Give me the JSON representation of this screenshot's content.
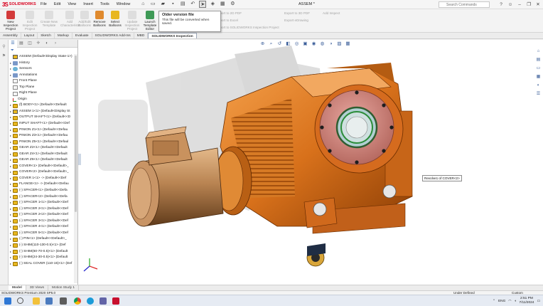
{
  "app": {
    "logo_text": "SOLIDWORKS",
    "document_title": "ASSEM *",
    "menu": [
      "File",
      "Edit",
      "View",
      "Insert",
      "Tools",
      "Window"
    ],
    "search_placeholder": "Search Commands"
  },
  "ribbon": {
    "buttons": [
      {
        "label": "New Inspection Project",
        "state": "enabled",
        "icon": "inspection-new-icon"
      },
      {
        "label": "Edit Inspection Project",
        "state": "disabled",
        "icon": "inspection-edit-icon"
      },
      {
        "label": "Create New Template",
        "state": "disabled",
        "icon": "template-new-icon"
      },
      {
        "label": "Add Characteristic",
        "state": "disabled",
        "icon": "characteristic-add-icon"
      },
      {
        "label": "Add/Edit Balloons",
        "state": "disabled",
        "icon": "balloon-edit-icon"
      },
      {
        "label": "Remove Balloons",
        "state": "enabled",
        "icon": "balloon-remove-icon"
      },
      {
        "label": "Select Balloons",
        "state": "enabled",
        "icon": "balloon-select-icon"
      },
      {
        "label": "Update Inspection Project",
        "state": "disabled",
        "icon": "inspection-update-icon"
      },
      {
        "label": "Launch Template Editor",
        "state": "enabled",
        "icon": "template-editor-icon"
      }
    ],
    "export_items": [
      "Export to 2D PDF",
      "Export to Excel",
      "Export to SOLIDWORKS Inspection Project",
      "Export to 3D PDF",
      "Export eDrawing",
      "Add Inspect"
    ],
    "tooltip": {
      "title": "Older version file",
      "body": "This file will be converted when saved."
    }
  },
  "tabs": [
    "Assembly",
    "Layout",
    "Sketch",
    "Markup",
    "Evaluate",
    "SOLIDWORKS Add-Ins",
    "MBD",
    "SOLIDWORKS Inspection"
  ],
  "active_tab": "SOLIDWORKS Inspection",
  "tree": {
    "root": "ASSEM  (Default<Display State-1>)",
    "items": [
      {
        "label": "History",
        "icon": "folder"
      },
      {
        "label": "Sensors",
        "icon": "sensor"
      },
      {
        "label": "Annotations",
        "icon": "folder"
      },
      {
        "label": "Front Plane",
        "icon": "plane"
      },
      {
        "label": "Top Plane",
        "icon": "plane"
      },
      {
        "label": "Right Plane",
        "icon": "plane"
      },
      {
        "label": "Origin",
        "icon": "origin"
      },
      {
        "label": "(f) BODY<1> (Default<<Default",
        "icon": "part"
      },
      {
        "label": "ASSEM 1<1> (Default<Display St",
        "icon": "asm"
      },
      {
        "label": "OUTPUT SHAFT<1> (Default<<D",
        "icon": "part"
      },
      {
        "label": "INPUT SHAFT<1> (Default<<Def",
        "icon": "part"
      },
      {
        "label": "PINION Z1<1> (Default<<Defau",
        "icon": "part"
      },
      {
        "label": "PINION Z3<1> (Default<<Defau",
        "icon": "part"
      },
      {
        "label": "PINION Z5<1> (Default<<Defaul",
        "icon": "part"
      },
      {
        "label": "GEAR Z2<1> (Default<<Default",
        "icon": "part"
      },
      {
        "label": "GEAR Z4<1> (Default<<Default",
        "icon": "part"
      },
      {
        "label": "GEAR Z6<1> (Default<<Default",
        "icon": "part"
      },
      {
        "label": "COVER<1> (Default<<Default>_",
        "icon": "part"
      },
      {
        "label": "COVER<2> (Default<<Default>_",
        "icon": "part"
      },
      {
        "label": "COVER 1<1> -> (Default<<Def",
        "icon": "part"
      },
      {
        "label": "FLANGE<1> -> (Default<<Defau",
        "icon": "part"
      },
      {
        "label": "(-) SPACER<1> (Default<<Defa",
        "icon": "part"
      },
      {
        "label": "(-) SPACER<2> (Default<<Defa",
        "icon": "part"
      },
      {
        "label": "(-) SPACER 1<1> (Default<<Def",
        "icon": "part"
      },
      {
        "label": "(-) SPACER 2<1> (Default<<Def",
        "icon": "part"
      },
      {
        "label": "(-) SPACER 2<2> (Default<<Def",
        "icon": "part"
      },
      {
        "label": "(-) SPACER 3<1> (Default<<Def",
        "icon": "part"
      },
      {
        "label": "(-) SPACER 4<1> (Default<<Def",
        "icon": "part"
      },
      {
        "label": "(-) SPACER 5<1> (Default<<Def",
        "icon": "part"
      },
      {
        "label": "(-) PIN<1> (Default<<Default>_",
        "icon": "part"
      },
      {
        "label": "(-) SHIM(110-130-0.5)<1> (Def",
        "icon": "part"
      },
      {
        "label": "(-) SHIM(60-70-0.5)<1> (Default",
        "icon": "part"
      },
      {
        "label": "(-) SHIM(24-30-0.5)<1> (Default",
        "icon": "part"
      },
      {
        "label": "(-) SEAL COVER (110-15)<1> (Def",
        "icon": "part"
      }
    ]
  },
  "viewport": {
    "callout": "Revolve1 of COVER<2>"
  },
  "bottom_tabs": [
    "Model",
    "3D Views",
    "Motion Study 1"
  ],
  "active_bottom_tab": "Model",
  "status": {
    "left": "SOLIDWORKS Premium 2020 SP5.0",
    "mid": "Under Defined",
    "right": "Custom"
  },
  "taskbar": {
    "lang": "ENG",
    "time": "2:51 PM",
    "date": "7/11/2024"
  },
  "colors": {
    "brand": "#d8001e",
    "part_orange": "#e07b22",
    "motor": "#c08a52"
  }
}
